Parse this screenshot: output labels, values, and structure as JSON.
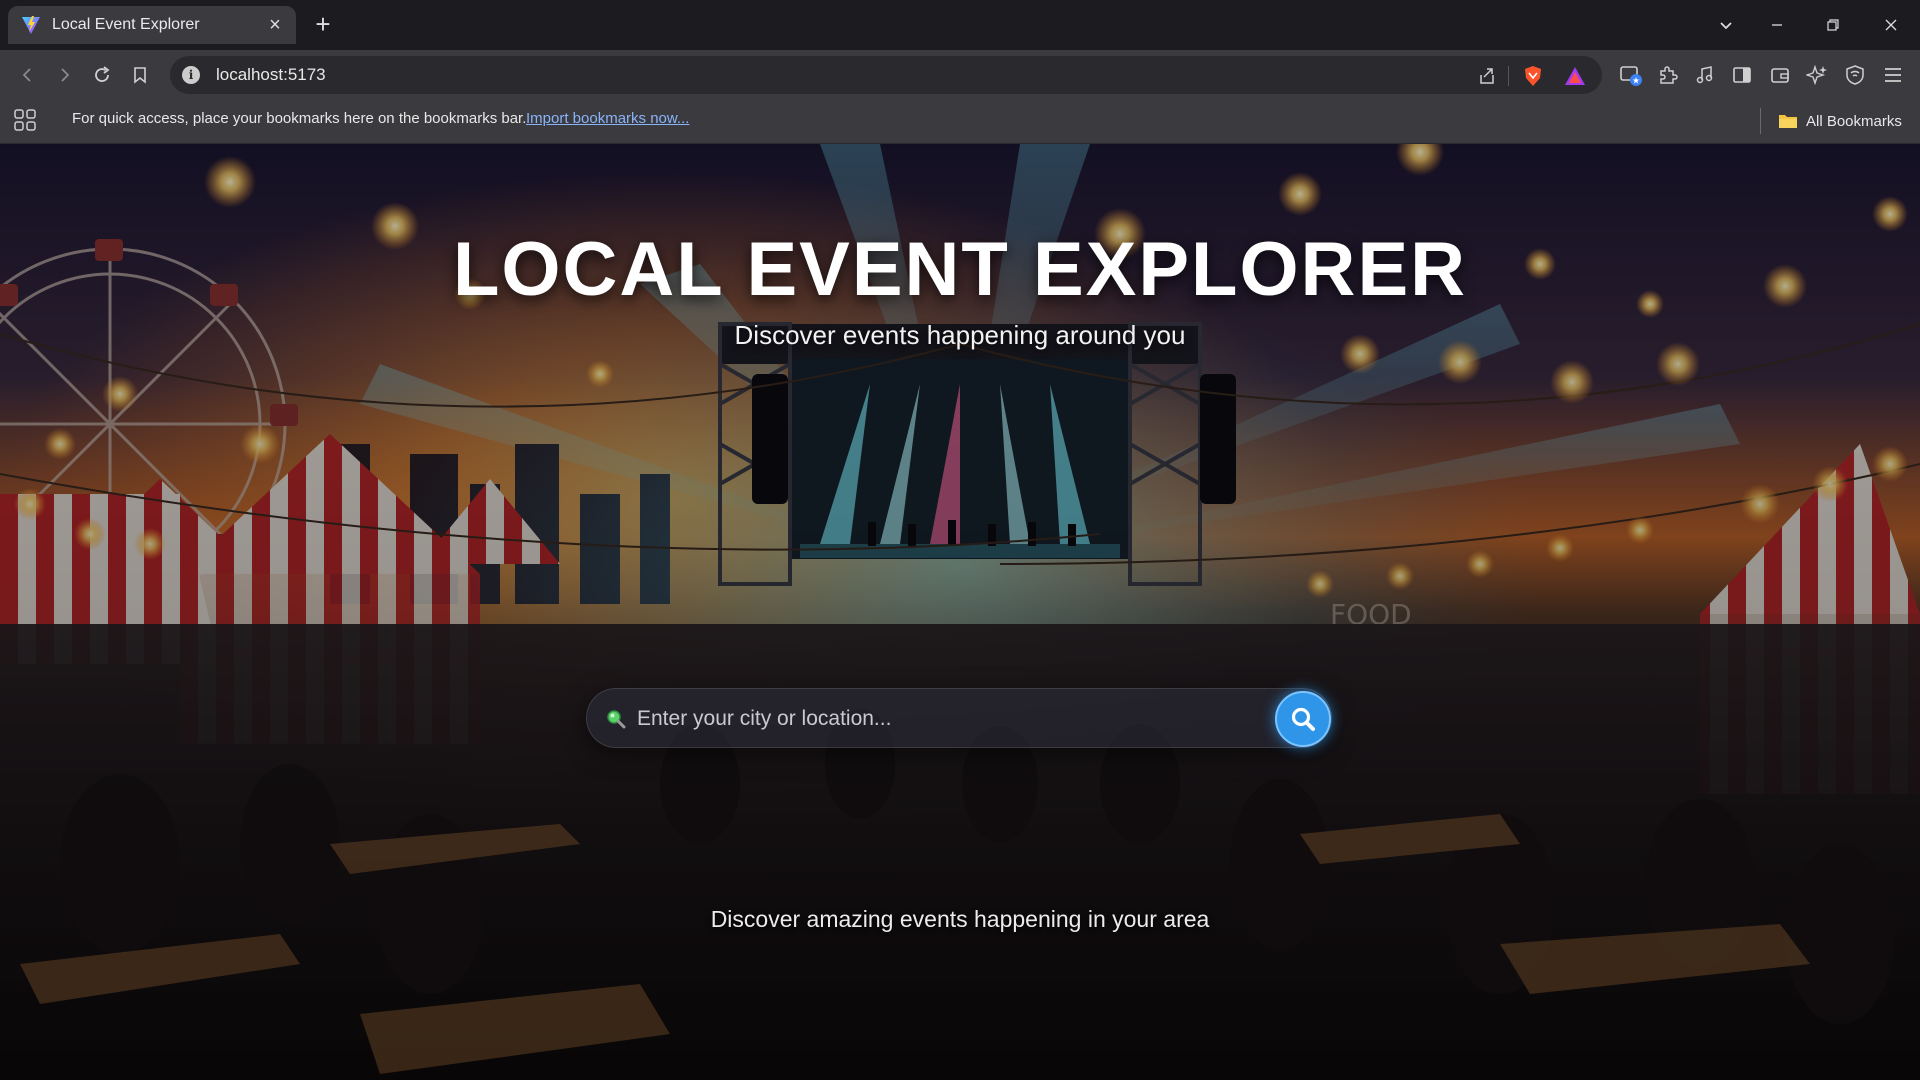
{
  "browser": {
    "tab_title": "Local Event Explorer",
    "url": "localhost:5173",
    "bookmarks_message": "For quick access, place your bookmarks here on the bookmarks bar.",
    "import_link": "Import bookmarks now...",
    "all_bookmarks": "All Bookmarks"
  },
  "hero": {
    "title": "LOCAL EVENT EXPLORER",
    "subtitle": "Discover events happening around you"
  },
  "search": {
    "placeholder": "Enter your city or location...",
    "value": ""
  },
  "footer_message": "Discover amazing events happening in your area",
  "colors": {
    "accent": "#2f95e8",
    "chrome_bg": "#3a3a3f",
    "tabstrip_bg": "#1c1c20",
    "link": "#8ab4f8"
  },
  "icons": [
    "vite-favicon",
    "close-icon",
    "plus-icon",
    "chevron-down-icon",
    "minimize-icon",
    "restore-icon",
    "window-close-icon",
    "back-icon",
    "forward-icon",
    "reload-icon",
    "bookmark-icon",
    "info-icon",
    "share-icon",
    "brave-shield-icon",
    "brave-rewards-icon",
    "tab-manager-icon",
    "extensions-icon",
    "music-icon",
    "sidebar-icon",
    "wallet-icon",
    "leo-ai-icon",
    "vpn-icon",
    "menu-icon",
    "apps-icon",
    "folder-icon",
    "search-icon"
  ]
}
